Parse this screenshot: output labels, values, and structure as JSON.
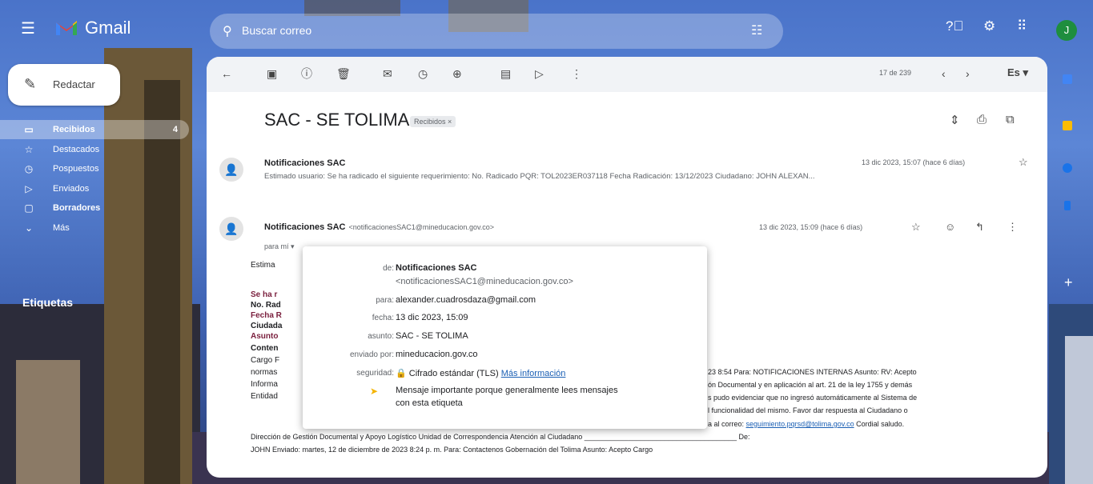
{
  "app": {
    "brand": "Gmail"
  },
  "search": {
    "placeholder": "Buscar correo"
  },
  "user": {
    "initial": "J"
  },
  "compose": {
    "label": "Redactar"
  },
  "nav": {
    "items": [
      {
        "label": "Recibidos",
        "icon": "inbox-icon",
        "count": "4"
      },
      {
        "label": "Destacados",
        "icon": "star-icon",
        "count": ""
      },
      {
        "label": "Pospuestos",
        "icon": "clock-icon",
        "count": ""
      },
      {
        "label": "Enviados",
        "icon": "send-icon",
        "count": ""
      },
      {
        "label": "Borradores",
        "icon": "draft-icon",
        "count": ""
      },
      {
        "label": "Más",
        "icon": "chevron-down-icon",
        "count": ""
      }
    ],
    "labels_title": "Etiquetas"
  },
  "toolbar": {
    "page_count": "17 de 239",
    "lang": "Es ▾"
  },
  "thread": {
    "subject": "SAC - SE TOLIMA",
    "label_chip": "Recibidos ×"
  },
  "message1": {
    "sender": "Notificaciones SAC",
    "snippet": "Estimado usuario: Se ha radicado el siguiente requerimiento: No. Radicado PQR: TOL2023ER037118 Fecha Radicación: 13/12/2023 Ciudadano: JOHN ALEXAN...",
    "date": "13 dic 2023, 15:07 (hace 6 días)"
  },
  "message2": {
    "sender": "Notificaciones SAC",
    "sender_email": "<notificacionesSAC1@mineducacion.gov.co>",
    "date": "13 dic 2023, 15:09 (hace 6 días)",
    "to": "para mí ▾",
    "body_left": [
      "Estima",
      "Se ha r",
      "No. Rad",
      "Fecha R",
      "Ciudada",
      "Asunto",
      "Conten",
      "Cargo F",
      "normas",
      "Informa",
      "Entidad"
    ],
    "body_right": [
      "23 8:54 Para: NOTIFICACIONES INTERNAS Asunto: RV: Acepto",
      "ón Documental y en aplicación al art. 21 de la ley 1755 y demás",
      "s pudo evidenciar que no ingresó automáticamente al Sistema de",
      "l funcionalidad del mismo. Favor dar respuesta al Ciudadano o"
    ],
    "body_line_mail_pre": "a al correo:",
    "body_line_mail_link": "seguimiento.pqrsd@tolima.gov.co",
    "body_line_mail_post": "Cordial saludo.",
    "body_footer1": "Dirección de Gestión Documental y Apoyo Logístico Unidad de Correspondencia Atención al Ciudadano ______________________________________ De:",
    "body_footer2": "JOHN Enviado: martes, 12 de diciembre de 2023 8:24 p. m. Para: Contactenos Gobernación del Tolima Asunto: Acepto Cargo"
  },
  "popup": {
    "de_label": "de:",
    "de_name": "Notificaciones SAC",
    "de_email": "<notificacionesSAC1@mineducacion.gov.co>",
    "para_label": "para:",
    "para_value": "alexander.cuadrosdaza@gmail.com",
    "fecha_label": "fecha:",
    "fecha_value": "13 dic 2023, 15:09",
    "asunto_label": "asunto:",
    "asunto_value": "SAC - SE TOLIMA",
    "enviado_label": "enviado por:",
    "enviado_value": "mineducacion.gov.co",
    "seguridad_label": "seguridad:",
    "seguridad_value": "🔒 Cifrado estándar (TLS)",
    "seguridad_link": "Más información",
    "importante_line1": "Mensaje importante porque generalmente lees mensajes",
    "importante_line2": "con esta etiqueta"
  }
}
